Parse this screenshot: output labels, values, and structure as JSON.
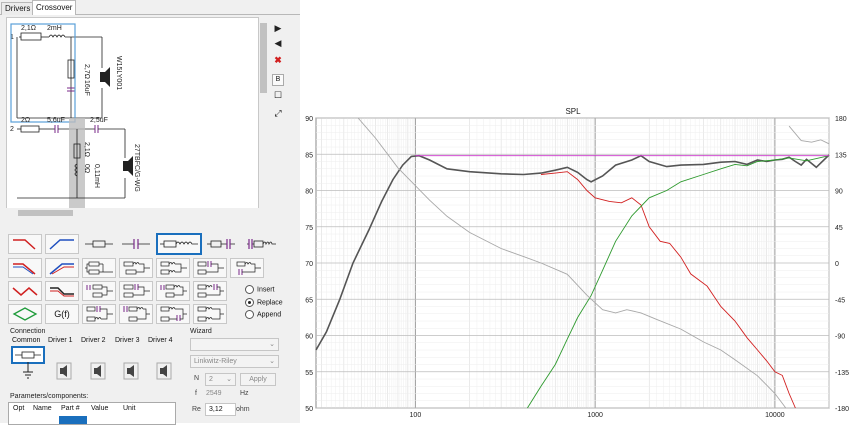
{
  "tabs": [
    "Drivers",
    "Crossover"
  ],
  "active_tab": "Crossover",
  "schematic": {
    "branch1": {
      "number": "1",
      "r1": "2,1Ω",
      "l1": "2mH",
      "r2": "2,7Ω",
      "c1": "16uF",
      "driver": "W15LY001"
    },
    "branch2": {
      "number": "2",
      "r1": "2Ω",
      "c1": "5,6uF",
      "c2": "2,5uF",
      "r2": "2,1Ω",
      "l1": "0,11mH",
      "r3": "0Ω",
      "driver": "27TBFC/G-WG"
    }
  },
  "side_buttons": [
    "play-right",
    "play-left",
    "delete",
    "B",
    "checkbox",
    "fit"
  ],
  "side_button_glyphs": [
    "▶",
    "◀",
    "✖",
    "B",
    "☐",
    "⤢"
  ],
  "mode_options": [
    "Insert",
    "Replace",
    "Append"
  ],
  "mode_selected": "Replace",
  "tool_gf_label": "G(f)",
  "connection": {
    "title": "Connection",
    "headers": [
      "Common",
      "Driver 1",
      "Driver 2",
      "Driver 3",
      "Driver 4"
    ]
  },
  "wizard": {
    "title": "Wizard",
    "filter_select": "",
    "alignment_select": "Linkwitz-Riley",
    "n_label": "N",
    "n_value": "2",
    "apply_label": "Apply",
    "f_label": "f",
    "f_value": "2549",
    "f_unit": "Hz",
    "re_label": "Re",
    "re_value": "3,12",
    "re_unit": "ohm"
  },
  "parameters": {
    "title": "Parameters/components:",
    "headers": [
      "Opt",
      "Name",
      "Part #",
      "Value",
      "Unit"
    ]
  },
  "chart_data": {
    "type": "line",
    "title": "SPL",
    "x_scale": "log",
    "xlim": [
      28,
      20000
    ],
    "ylim_left": [
      50,
      90
    ],
    "ylim_right": [
      -180,
      180
    ],
    "x_tick_labels": [
      {
        "x": 100,
        "label": "100"
      },
      {
        "x": 1000,
        "label": "1000"
      },
      {
        "x": 10000,
        "label": "10000"
      }
    ],
    "y_left_ticks": [
      90,
      85,
      80,
      75,
      70,
      65,
      60,
      55,
      50
    ],
    "y_right_ticks": [
      180,
      135,
      90,
      45,
      0,
      -45,
      -90,
      -135,
      -180
    ],
    "grid": true,
    "series": [
      {
        "color": "#555555",
        "axis": "left",
        "points": [
          [
            28,
            58
          ],
          [
            32,
            60.5
          ],
          [
            38,
            65
          ],
          [
            45,
            70
          ],
          [
            55,
            74.5
          ],
          [
            65,
            78.5
          ],
          [
            75,
            81.5
          ],
          [
            85,
            83.5
          ],
          [
            95,
            84.7
          ],
          [
            105,
            84.8
          ],
          [
            120,
            84.2
          ],
          [
            150,
            83
          ],
          [
            200,
            82.6
          ],
          [
            300,
            82.3
          ],
          [
            400,
            82.2
          ],
          [
            500,
            82.4
          ],
          [
            600,
            82.8
          ],
          [
            700,
            83.2
          ],
          [
            800,
            82.5
          ],
          [
            900,
            81.5
          ],
          [
            950,
            81.2
          ],
          [
            1100,
            82
          ],
          [
            1300,
            83.5
          ],
          [
            1600,
            84.2
          ],
          [
            1800,
            84.8
          ],
          [
            2000,
            84
          ],
          [
            2500,
            83.3
          ],
          [
            3000,
            83.5
          ],
          [
            4000,
            83.6
          ],
          [
            5000,
            83.9
          ],
          [
            6000,
            84
          ],
          [
            7000,
            83.6
          ],
          [
            8000,
            84.2
          ],
          [
            9000,
            84
          ],
          [
            10000,
            84.2
          ],
          [
            11000,
            84.3
          ],
          [
            12000,
            84.6
          ],
          [
            13000,
            84
          ],
          [
            14000,
            83.5
          ],
          [
            15000,
            84.3
          ],
          [
            17000,
            83.2
          ],
          [
            20000,
            84.9
          ]
        ]
      },
      {
        "color": "#d22020",
        "axis": "left",
        "points": [
          [
            500,
            82.2
          ],
          [
            600,
            82.4
          ],
          [
            700,
            82.6
          ],
          [
            800,
            81.5
          ],
          [
            900,
            80
          ],
          [
            1000,
            79
          ],
          [
            1200,
            78.5
          ],
          [
            1400,
            78.3
          ],
          [
            1600,
            79
          ],
          [
            1800,
            78
          ],
          [
            2000,
            75
          ],
          [
            2300,
            73
          ],
          [
            2600,
            72.7
          ],
          [
            3000,
            70.8
          ],
          [
            3400,
            68.5
          ],
          [
            3800,
            67.6
          ],
          [
            4200,
            66.8
          ],
          [
            5000,
            64
          ],
          [
            6000,
            62
          ],
          [
            7000,
            59.7
          ],
          [
            8000,
            58
          ],
          [
            9000,
            56.5
          ],
          [
            10000,
            55
          ],
          [
            11000,
            54.5
          ],
          [
            12000,
            52
          ],
          [
            13000,
            50
          ]
        ]
      },
      {
        "color": "#2f9a2f",
        "axis": "left",
        "points": [
          [
            420,
            50
          ],
          [
            500,
            53
          ],
          [
            600,
            56
          ],
          [
            700,
            59.5
          ],
          [
            800,
            62.5
          ],
          [
            950,
            65.5
          ],
          [
            1100,
            69
          ],
          [
            1300,
            73
          ],
          [
            1600,
            76.5
          ],
          [
            2000,
            79
          ],
          [
            2500,
            80
          ],
          [
            3000,
            81.2
          ],
          [
            4000,
            82.2
          ],
          [
            5000,
            83
          ],
          [
            6000,
            83.6
          ],
          [
            7000,
            83.4
          ],
          [
            8000,
            84
          ],
          [
            10000,
            84.2
          ],
          [
            12000,
            84.5
          ],
          [
            15000,
            84.1
          ],
          [
            20000,
            84.8
          ]
        ]
      },
      {
        "color": "#cc33cc",
        "axis": "left",
        "points": [
          [
            100,
            84.8
          ],
          [
            20000,
            84.8
          ]
        ]
      },
      {
        "color": "#a8a8a8",
        "axis": "right",
        "points": [
          [
            48,
            180
          ],
          [
            60,
            155
          ],
          [
            80,
            118
          ],
          [
            100,
            96
          ],
          [
            120,
            78
          ],
          [
            150,
            58
          ],
          [
            200,
            38
          ],
          [
            300,
            18
          ],
          [
            400,
            8
          ],
          [
            500,
            0
          ],
          [
            700,
            -14
          ],
          [
            900,
            -40
          ],
          [
            1100,
            -58
          ],
          [
            1300,
            -62
          ],
          [
            1500,
            -58
          ],
          [
            1800,
            -62
          ],
          [
            2200,
            -70
          ],
          [
            3000,
            -82
          ],
          [
            4000,
            -98
          ],
          [
            5000,
            -108
          ],
          [
            6000,
            -120
          ],
          [
            8000,
            -140
          ],
          [
            10000,
            -162
          ],
          [
            11500,
            -180
          ],
          [
            12000,
            170
          ],
          [
            14000,
            152
          ],
          [
            16000,
            150
          ],
          [
            18000,
            153
          ],
          [
            20000,
            148
          ]
        ]
      }
    ]
  }
}
